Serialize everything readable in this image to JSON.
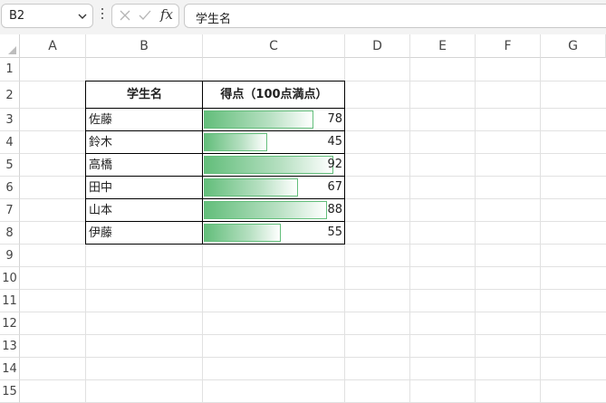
{
  "formula_bar": {
    "name_box": "B2",
    "fx_label": "fx",
    "content": "学生名"
  },
  "columns": [
    "A",
    "B",
    "C",
    "D",
    "E",
    "F",
    "G"
  ],
  "rows": [
    "1",
    "2",
    "3",
    "4",
    "5",
    "6",
    "7",
    "8",
    "9",
    "10",
    "11",
    "12",
    "13",
    "14",
    "15"
  ],
  "table": {
    "headers": [
      "学生名",
      "得点（100点満点）"
    ],
    "students": [
      {
        "name": "佐藤",
        "score": 78
      },
      {
        "name": "鈴木",
        "score": 45
      },
      {
        "name": "高橋",
        "score": 92
      },
      {
        "name": "田中",
        "score": 67
      },
      {
        "name": "山本",
        "score": 88
      },
      {
        "name": "伊藤",
        "score": 55
      }
    ],
    "data_bar_color": "#63be7b",
    "data_bar_max": 100
  }
}
